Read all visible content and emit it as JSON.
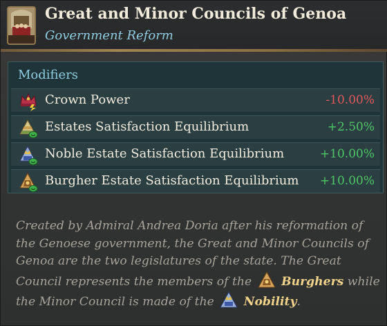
{
  "header": {
    "title": "Great and Minor Councils of Genoa",
    "subtitle": "Government Reform",
    "portrait_icon": "council-portrait-icon"
  },
  "modifiers": {
    "heading": "Modifiers",
    "items": [
      {
        "label": "Crown Power",
        "value": "-10.00%",
        "icon": "crown-power-icon",
        "tone": "negative"
      },
      {
        "label": "Estates Satisfaction Equilibrium",
        "value": "+2.50%",
        "icon": "estates-icon",
        "tone": "positive"
      },
      {
        "label": "Noble Estate Satisfaction Equilibrium",
        "value": "+10.00%",
        "icon": "nobility-icon",
        "tone": "positive"
      },
      {
        "label": "Burgher Estate Satisfaction Equilibrium",
        "value": "+10.00%",
        "icon": "burghers-icon",
        "tone": "positive"
      }
    ]
  },
  "description": {
    "part1": "Created by Admiral Andrea Doria after his reformation of the Genoese government, the Great and Minor Councils of Genoa are the two legislatures of the state. The Great Council represents the members of the",
    "burghers": "Burghers",
    "part2": "while the Minor Council is made of the",
    "nobility": "Nobility",
    "part3": "."
  },
  "colors": {
    "title": "#f1ebdc",
    "subtitle": "#8fcde0",
    "negative": "#e3585c",
    "positive": "#4ec766",
    "highlight": "#f0d28a",
    "description": "#a7a39a"
  }
}
